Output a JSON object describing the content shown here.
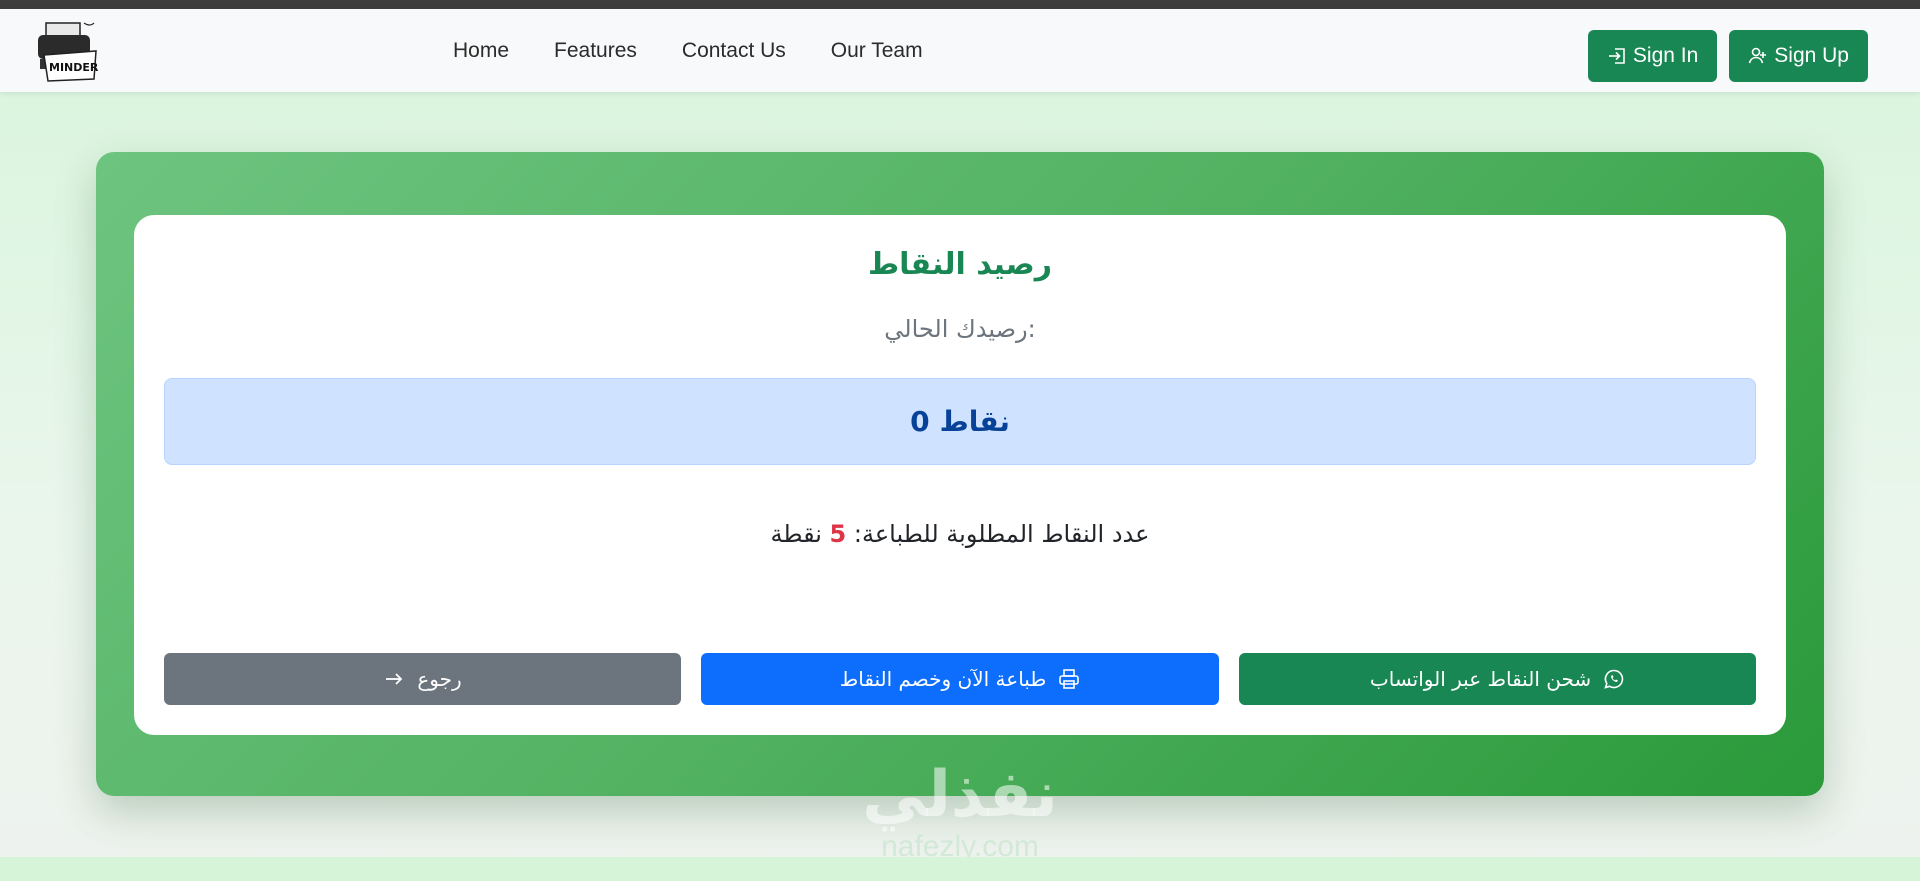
{
  "navbar": {
    "logo_text": "MINDER",
    "links": [
      "Home",
      "Features",
      "Contact Us",
      "Our Team"
    ],
    "sign_in": "Sign In",
    "sign_up": "Sign Up"
  },
  "card": {
    "title": "رصيد النقاط",
    "subtitle": "رصيدك الحالي:",
    "points_value": "0",
    "points_unit": "نقاط",
    "required_label": "عدد النقاط المطلوبة للطباعة:",
    "required_value": "5",
    "required_unit": "نقطة"
  },
  "actions": {
    "whatsapp": "شحن النقاط عبر الواتساب",
    "print": "طباعة الآن وخصم النقاط",
    "back": "رجوع"
  },
  "watermark": {
    "arabic": "نفذلي",
    "english": "nafezly.com"
  },
  "colors": {
    "primary": "#0d6efd",
    "success": "#198754",
    "secondary": "#6c757d",
    "danger": "#dc3545",
    "info_bg": "#cfe2ff",
    "info_text": "#084298"
  },
  "icons": {
    "sign_in": "box-arrow-in-icon",
    "sign_up": "person-plus-icon",
    "whatsapp": "whatsapp-icon",
    "print": "printer-icon",
    "back": "arrow-right-icon"
  }
}
